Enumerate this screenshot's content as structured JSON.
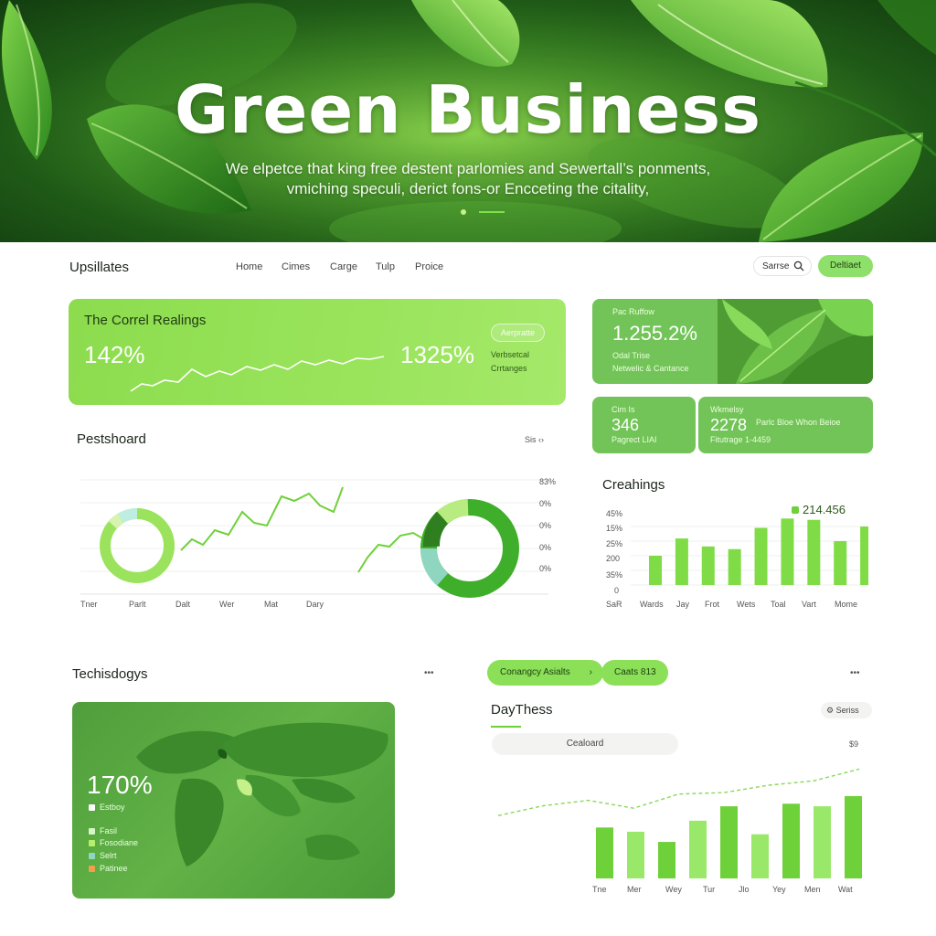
{
  "hero": {
    "title": "Green  Business",
    "subtitle_line1": "We elpetce that king free destent parlomies and Sewertall’s ponments,",
    "subtitle_line2": "vmiching speculi, derict fons-or Encceting the citality,"
  },
  "nav": {
    "brand": "Upsillates",
    "links": [
      "Home",
      "Cimes",
      "Carge",
      "Tulp",
      "Proice"
    ],
    "search_label": "Sarrse",
    "button_label": "Deltiaet"
  },
  "card_top_left": {
    "title": "The Correl Realings",
    "value_left": "142%",
    "value_right": "1325%",
    "pill": "Aerpratte",
    "note_line1": "Verbsetcal",
    "note_line2": "Crrtanges"
  },
  "card_top_right": {
    "label_top": "Pac Ruffow",
    "value": "1.255.2%",
    "label_line1": "Odal Trise",
    "label_line2": "Netwelic & Cantance"
  },
  "card_small_a": {
    "label_top": "Cim Is",
    "value": "346",
    "label_bottom": "Pagrect LIAI"
  },
  "card_small_b": {
    "label_top": "Wkmelsy",
    "value": "2278",
    "side": "Parlc Bloe Whon Beioe",
    "label_bottom": "Fitutrage  1-4459"
  },
  "dashboard": {
    "title": "Pestshoard",
    "menu": "Sis  ‹›",
    "x_labels": [
      "Tner",
      "Parlt",
      "Dalt",
      "Wer",
      "Mat",
      "Dary"
    ],
    "y_labels": [
      "83%",
      "0%",
      "0%",
      "0%",
      "0%"
    ]
  },
  "creahings": {
    "title": "Creahings",
    "legend_value": "214.456",
    "y_labels": [
      "45%",
      "15%",
      "25%",
      "200",
      "35%",
      "0",
      "SaR"
    ],
    "categories": [
      "Wards",
      "Jay",
      "Frot",
      "Wets",
      "Toal",
      "Vart",
      "Mome"
    ],
    "values": [
      22,
      35,
      29,
      27,
      43,
      50,
      49,
      33,
      44
    ]
  },
  "techisdogys": {
    "title": "Techisdogys",
    "menu": "•••",
    "value": "170%",
    "legend": [
      {
        "label": "Estboy",
        "color": "#ffffff"
      },
      {
        "label": "Fasil",
        "color": "#d8f5c8"
      },
      {
        "label": "Fosodiane",
        "color": "#b6f06a"
      },
      {
        "label": "Selrt",
        "color": "#8fd6c0"
      },
      {
        "label": "Patinee",
        "color": "#f0a04a"
      }
    ]
  },
  "daythess": {
    "tab1": "Conangcy Asialts",
    "tab2": "Caats 813",
    "menu": "•••",
    "title": "DayThess",
    "series_btn": "Seriss",
    "search_label": "Cealoard",
    "top_value": "$9",
    "categories": [
      "Tne",
      "Mer",
      "Wey",
      "Tur",
      "Jlo",
      "Yey",
      "Men",
      "Wat"
    ],
    "bar_values": [
      60,
      55,
      43,
      68,
      85,
      52,
      88,
      85,
      97
    ],
    "line_values": [
      35,
      55,
      66,
      50,
      79,
      82,
      97,
      106,
      130
    ]
  },
  "colors": {
    "accent": "#8be058",
    "accent_dark": "#3fae2a",
    "muted": "#a8e88c"
  },
  "icons": [
    "search-icon",
    "chevron-right-icon",
    "more-icon"
  ]
}
